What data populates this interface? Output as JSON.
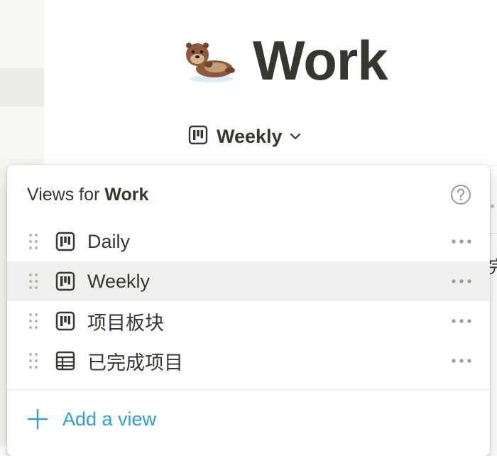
{
  "page": {
    "title": "Work",
    "icon": "sea-otter-emoji"
  },
  "view_switcher": {
    "label": "Weekly",
    "icon": "board-icon"
  },
  "popup": {
    "title_prefix": "Views for ",
    "title_name": "Work",
    "views": [
      {
        "label": "Daily",
        "icon": "board-icon",
        "active": false
      },
      {
        "label": "Weekly",
        "icon": "board-icon",
        "active": true
      },
      {
        "label": "项目板块",
        "icon": "board-icon",
        "active": false
      },
      {
        "label": "已完成项目",
        "icon": "table-icon",
        "active": false
      }
    ],
    "add_view_label": "Add a view"
  },
  "background": {
    "peek_char": "完"
  },
  "colors": {
    "text": "#37352f",
    "accent_blue": "#2f9ed8",
    "active_row": "#efefee",
    "sidebar": "#f7f6f3"
  }
}
